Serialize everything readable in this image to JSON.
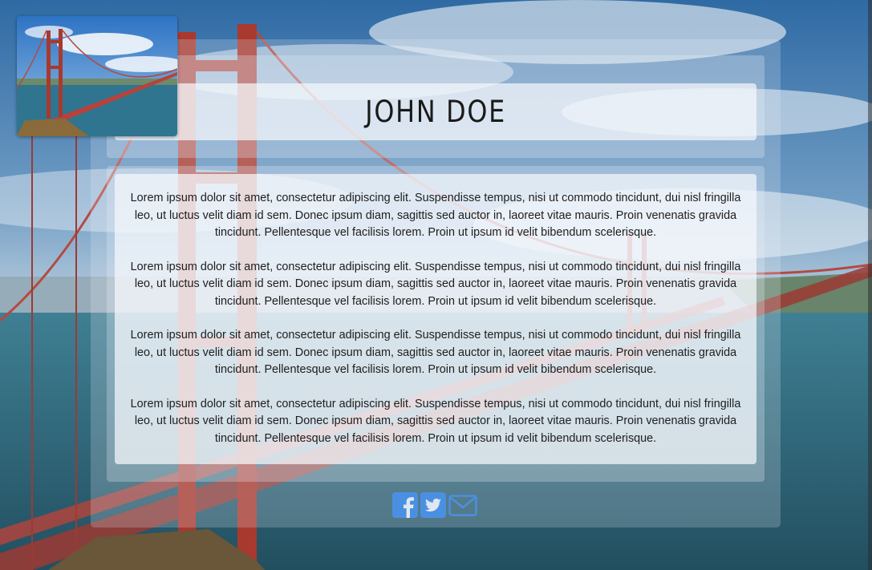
{
  "profile": {
    "name": "JOHN DOE"
  },
  "content": {
    "paragraphs": [
      "Lorem ipsum dolor sit amet, consectetur adipiscing elit. Suspendisse tempus, nisi ut commodo tincidunt, dui nisl fringilla leo, ut luctus velit diam id sem. Donec ipsum diam, sagittis sed auctor in, laoreet vitae mauris. Proin venenatis gravida tincidunt. Pellentesque vel facilisis lorem. Proin ut ipsum id velit bibendum scelerisque.",
      "Lorem ipsum dolor sit amet, consectetur adipiscing elit. Suspendisse tempus, nisi ut commodo tincidunt, dui nisl fringilla leo, ut luctus velit diam id sem. Donec ipsum diam, sagittis sed auctor in, laoreet vitae mauris. Proin venenatis gravida tincidunt. Pellentesque vel facilisis lorem. Proin ut ipsum id velit bibendum scelerisque.",
      "Lorem ipsum dolor sit amet, consectetur adipiscing elit. Suspendisse tempus, nisi ut commodo tincidunt, dui nisl fringilla leo, ut luctus velit diam id sem. Donec ipsum diam, sagittis sed auctor in, laoreet vitae mauris. Proin venenatis gravida tincidunt. Pellentesque vel facilisis lorem. Proin ut ipsum id velit bibendum scelerisque.",
      "Lorem ipsum dolor sit amet, consectetur adipiscing elit. Suspendisse tempus, nisi ut commodo tincidunt, dui nisl fringilla leo, ut luctus velit diam id sem. Donec ipsum diam, sagittis sed auctor in, laoreet vitae mauris. Proin venenatis gravida tincidunt. Pellentesque vel facilisis lorem. Proin ut ipsum id velit bibendum scelerisque."
    ]
  },
  "social": {
    "icons": [
      "facebook-icon",
      "twitter-icon",
      "email-icon"
    ],
    "color": "#4a90e2"
  },
  "theme": {
    "bridge_red": "#b8423a",
    "sky_blue": "#4f86b8",
    "water_teal": "#2f6f80"
  }
}
